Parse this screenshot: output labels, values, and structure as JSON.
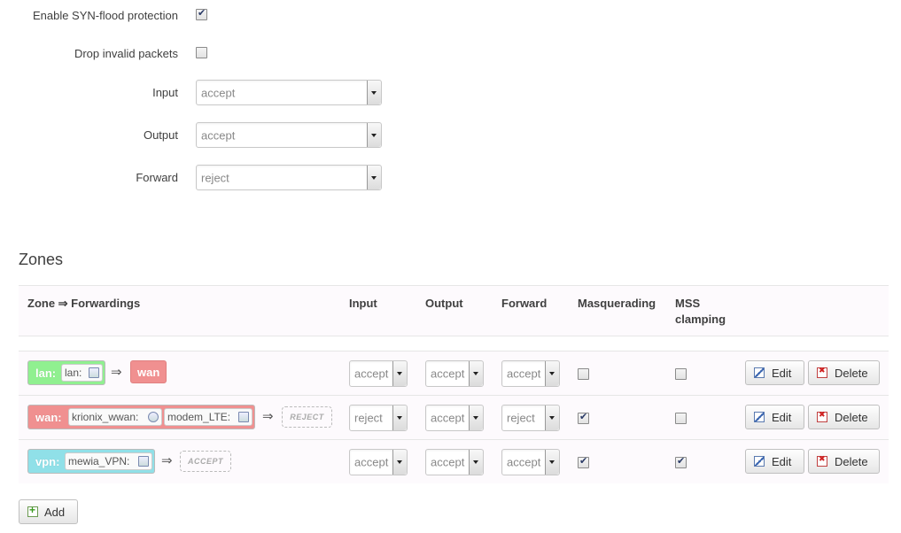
{
  "general": {
    "syn_flood": {
      "label": "Enable SYN-flood protection",
      "checked": true
    },
    "drop_invalid": {
      "label": "Drop invalid packets",
      "checked": false
    },
    "input": {
      "label": "Input",
      "value": "accept"
    },
    "output": {
      "label": "Output",
      "value": "accept"
    },
    "forward": {
      "label": "Forward",
      "value": "reject"
    }
  },
  "zones": {
    "title": "Zones",
    "headers": {
      "zone": "Zone ⇒ Forwardings",
      "input": "Input",
      "output": "Output",
      "forward": "Forward",
      "masquerading": "Masquerading",
      "mss1": "MSS",
      "mss2": "clamping"
    },
    "rows": [
      {
        "name": "lan:",
        "devices": [
          "lan:"
        ],
        "target": "wan",
        "input": "accept",
        "output": "accept",
        "forward": "accept",
        "masq": false,
        "mss": false,
        "edit": "Edit",
        "delete": "Delete"
      },
      {
        "name": "wan:",
        "devices": [
          "krionix_wwan:",
          "modem_LTE:"
        ],
        "target": "REJECT",
        "input": "reject",
        "output": "accept",
        "forward": "reject",
        "masq": true,
        "mss": false,
        "edit": "Edit",
        "delete": "Delete"
      },
      {
        "name": "vpn:",
        "devices": [
          "mewia_VPN:"
        ],
        "target": "ACCEPT",
        "input": "accept",
        "output": "accept",
        "forward": "accept",
        "masq": true,
        "mss": true,
        "edit": "Edit",
        "delete": "Delete"
      }
    ],
    "add_label": "Add",
    "arrow": "⇒"
  },
  "colors": {
    "lan": "#90f090",
    "wan": "#f09090",
    "vpn": "#90e0e8"
  }
}
